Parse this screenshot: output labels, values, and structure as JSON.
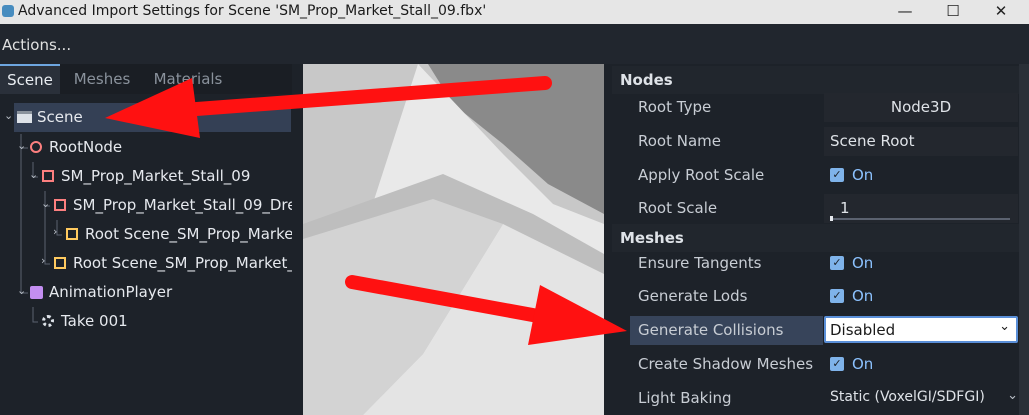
{
  "window": {
    "title": "Advanced Import Settings for Scene 'SM_Prop_Market_Stall_09.fbx'",
    "minimize": "—",
    "maximize": "☐",
    "close": "✕"
  },
  "menu": {
    "actions": "Actions..."
  },
  "tabs": [
    "Scene",
    "Meshes",
    "Materials"
  ],
  "tree": [
    {
      "label": "Scene",
      "icon": "clapperboard-icon",
      "expanded": true,
      "selected": true
    },
    {
      "label": "RootNode",
      "icon": "node3d-icon",
      "expanded": true
    },
    {
      "label": "SM_Prop_Market_Stall_09",
      "icon": "mesh-instance-icon",
      "expanded": true
    },
    {
      "label": "SM_Prop_Market_Stall_09_Dre",
      "icon": "mesh-instance-icon",
      "expanded": true
    },
    {
      "label": "Root Scene_SM_Prop_Marke",
      "icon": "static-body-icon",
      "expanded": false
    },
    {
      "label": "Root Scene_SM_Prop_Market_",
      "icon": "static-body-icon",
      "expanded": false
    },
    {
      "label": "AnimationPlayer",
      "icon": "animation-player-icon",
      "expanded": true
    },
    {
      "label": "Take 001",
      "icon": "animation-icon"
    }
  ],
  "inspector": {
    "nodes_header": "Nodes",
    "root_type_label": "Root Type",
    "root_type_value": "Node3D",
    "root_name_label": "Root Name",
    "root_name_value": "Scene Root",
    "apply_root_scale_label": "Apply Root Scale",
    "apply_root_scale_value": "On",
    "root_scale_label": "Root Scale",
    "root_scale_value": "1",
    "meshes_header": "Meshes",
    "ensure_tangents_label": "Ensure Tangents",
    "ensure_tangents_value": "On",
    "generate_lods_label": "Generate Lods",
    "generate_lods_value": "On",
    "generate_collisions_label": "Generate Collisions",
    "generate_collisions_value": "Disabled",
    "create_shadow_meshes_label": "Create Shadow Meshes",
    "create_shadow_meshes_value": "On",
    "light_baking_label": "Light Baking",
    "light_baking_value": "Static (VoxelGI/SDFGI)"
  },
  "colors": {
    "accent": "#7fb3ea",
    "arrow": "#ff1111",
    "selection": "#344055"
  }
}
